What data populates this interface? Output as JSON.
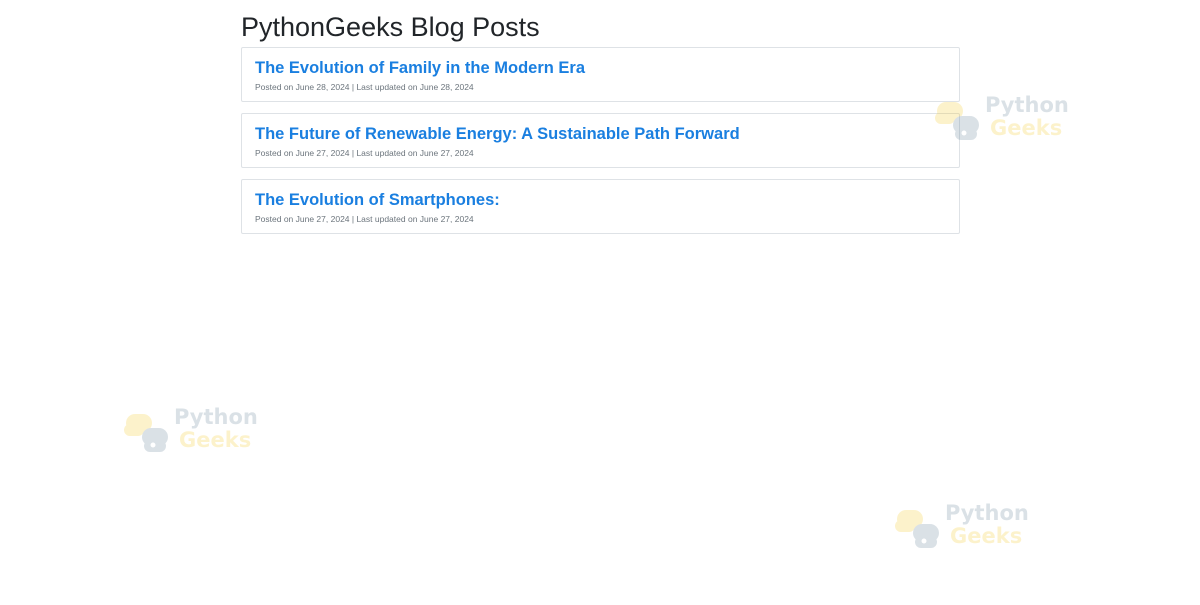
{
  "page": {
    "title": "PythonGeeks Blog Posts"
  },
  "posts": [
    {
      "title": "The Evolution of Family in the Modern Era",
      "meta": "Posted on June 28, 2024 | Last updated on June 28, 2024"
    },
    {
      "title": "The Future of Renewable Energy: A Sustainable Path Forward",
      "meta": "Posted on June 27, 2024 | Last updated on June 27, 2024"
    },
    {
      "title": "The Evolution of Smartphones:",
      "meta": "Posted on June 27, 2024 | Last updated on June 27, 2024"
    }
  ],
  "watermark": {
    "line1": "Python",
    "line2": "Geeks",
    "icon": "python-geeks-logo-icon",
    "colors": {
      "blue": "#5b7b93",
      "yellow": "#f5c518"
    }
  },
  "colors": {
    "link": "#1a7fe0",
    "meta": "#6c757d",
    "border": "#dee2e6",
    "heading": "#212529"
  }
}
